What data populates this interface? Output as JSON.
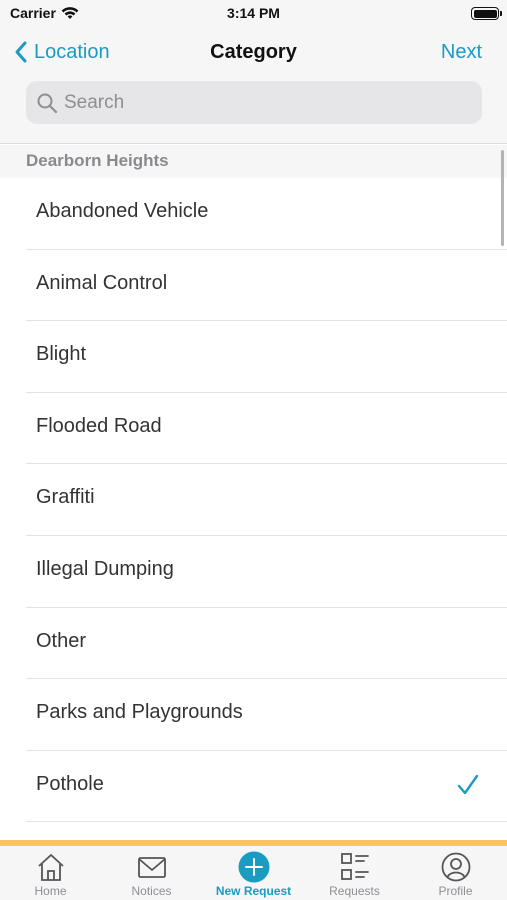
{
  "status_bar": {
    "carrier": "Carrier",
    "time": "3:14 PM"
  },
  "nav": {
    "back_label": "Location",
    "title": "Category",
    "next_label": "Next"
  },
  "search": {
    "placeholder": "Search",
    "value": ""
  },
  "section": {
    "title": "Dearborn Heights"
  },
  "categories": [
    {
      "label": "Abandoned Vehicle",
      "selected": false
    },
    {
      "label": "Animal Control",
      "selected": false
    },
    {
      "label": "Blight",
      "selected": false
    },
    {
      "label": "Flooded Road",
      "selected": false
    },
    {
      "label": "Graffiti",
      "selected": false
    },
    {
      "label": "Illegal Dumping",
      "selected": false
    },
    {
      "label": "Other",
      "selected": false
    },
    {
      "label": "Parks and Playgrounds",
      "selected": false
    },
    {
      "label": "Pothole",
      "selected": true
    }
  ],
  "tabs": [
    {
      "label": "Home",
      "icon": "home-icon",
      "active": false
    },
    {
      "label": "Notices",
      "icon": "envelope-icon",
      "active": false
    },
    {
      "label": "New Request",
      "icon": "plus-circle-icon",
      "active": true
    },
    {
      "label": "Requests",
      "icon": "list-icon",
      "active": false
    },
    {
      "label": "Profile",
      "icon": "profile-icon",
      "active": false
    }
  ],
  "colors": {
    "accent": "#1a9bc2",
    "tab_bar_top_border": "#f6c65b",
    "inactive": "#8e8e93"
  }
}
